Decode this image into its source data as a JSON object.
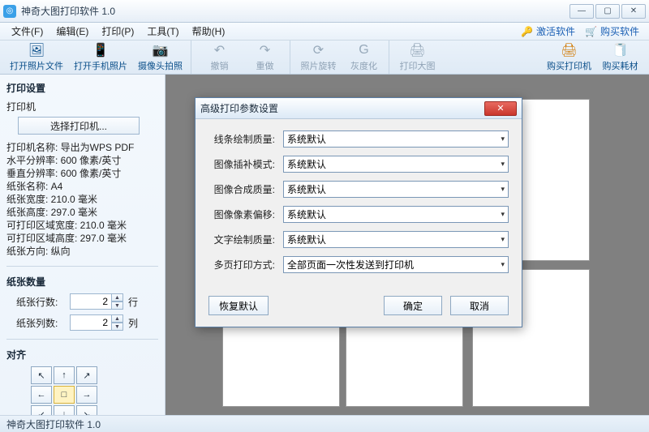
{
  "window": {
    "title": "神奇大图打印软件 1.0"
  },
  "menus": {
    "file": "文件(F)",
    "edit": "编辑(E)",
    "print": "打印(P)",
    "tools": "工具(T)",
    "help": "帮助(H)"
  },
  "header_right": {
    "activate": "激活软件",
    "buy": "购买软件"
  },
  "toolbar": {
    "open_image": "打开照片文件",
    "open_phone": "打开手机照片",
    "camera": "摄像头拍照",
    "undo": "撤销",
    "redo": "重做",
    "rotate": "照片旋转",
    "grayscale": "灰度化",
    "print_big": "打印大图",
    "buy_printer": "购买打印机",
    "buy_supplies": "购买耗材"
  },
  "sidebar": {
    "section_print_settings": "打印设置",
    "printer_heading": "打印机",
    "select_printer_btn": "选择打印机...",
    "info": {
      "l1": "打印机名称: 导出为WPS PDF",
      "l2": "水平分辨率: 600 像素/英寸",
      "l3": "垂直分辨率: 600 像素/英寸",
      "l4": "纸张名称: A4",
      "l5": "纸张宽度: 210.0 毫米",
      "l6": "纸张高度: 297.0 毫米",
      "l7": "可打印区域宽度: 210.0 毫米",
      "l8": "可打印区域高度: 297.0 毫米",
      "l9": "纸张方向: 纵向"
    },
    "section_paper_count": "纸张数量",
    "rows_label": "纸张行数:",
    "rows_value": "2",
    "rows_unit": "行",
    "cols_label": "纸张列数:",
    "cols_value": "2",
    "cols_unit": "列",
    "section_align": "对齐"
  },
  "statusbar": {
    "text": "神奇大图打印软件 1.0"
  },
  "dialog": {
    "title": "高级打印参数设置",
    "rows": [
      {
        "label": "线条绘制质量:",
        "value": "系统默认"
      },
      {
        "label": "图像插补模式:",
        "value": "系统默认"
      },
      {
        "label": "图像合成质量:",
        "value": "系统默认"
      },
      {
        "label": "图像像素偏移:",
        "value": "系统默认"
      },
      {
        "label": "文字绘制质量:",
        "value": "系统默认"
      },
      {
        "label": "多页打印方式:",
        "value": "全部页面一次性发送到打印机"
      }
    ],
    "restore": "恢复默认",
    "ok": "确定",
    "cancel": "取消"
  },
  "align_arrows": [
    "↖",
    "↑",
    "↗",
    "←",
    "□",
    "→",
    "↙",
    "↓",
    "↘"
  ]
}
